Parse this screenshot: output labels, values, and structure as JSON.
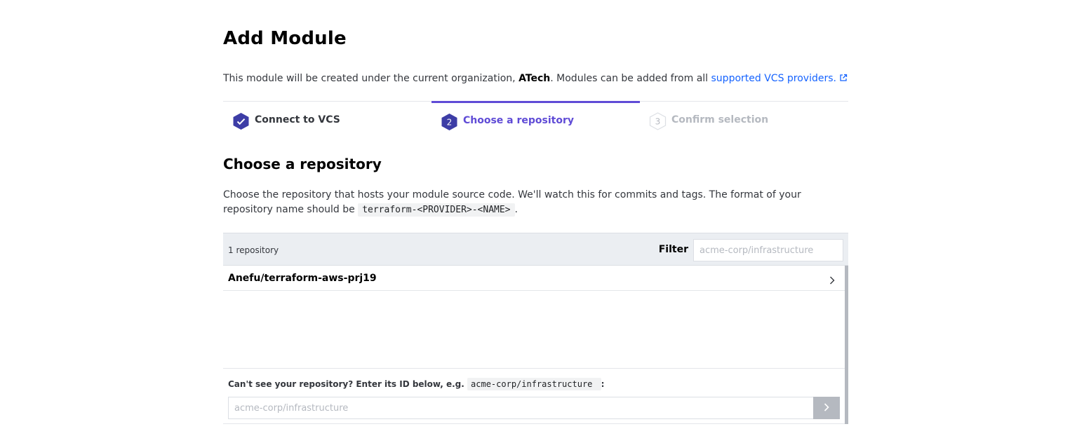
{
  "header": {
    "title": "Add Module"
  },
  "intro": {
    "text_before": "This module will be created under the current organization, ",
    "organization": "ATech",
    "text_after": ". Modules can be added from all ",
    "link_label": "supported VCS providers."
  },
  "stepper": {
    "steps": [
      {
        "label": "Connect to VCS",
        "state": "complete",
        "icon": "check-icon"
      },
      {
        "label": "Choose a repository",
        "state": "active",
        "number": "2"
      },
      {
        "label": "Confirm selection",
        "state": "pending",
        "number": "3"
      }
    ]
  },
  "section": {
    "title": "Choose a repository",
    "description": "Choose the repository that hosts your module source code. We'll watch this for commits and tags. The format of your repository name should be ",
    "format_code": "terraform-<PROVIDER>-<NAME>",
    "description_end": "."
  },
  "repositories": {
    "count_label": "1 repository",
    "filter_label": "Filter",
    "filter_placeholder": "acme-corp/infrastructure",
    "items": [
      {
        "name": "Anefu/terraform-aws-prj19"
      }
    ]
  },
  "manual_entry": {
    "label": "Can't see your repository? Enter its ID below, e.g.",
    "example_code": "acme-corp/infrastructure ",
    "label_end": ":",
    "placeholder": "acme-corp/infrastructure"
  },
  "colors": {
    "accent": "#5f4bd6",
    "step_complete": "#3d3da6",
    "link": "#1563ff",
    "header_bg": "#ebeef2",
    "disabled": "#b5b9c0"
  }
}
